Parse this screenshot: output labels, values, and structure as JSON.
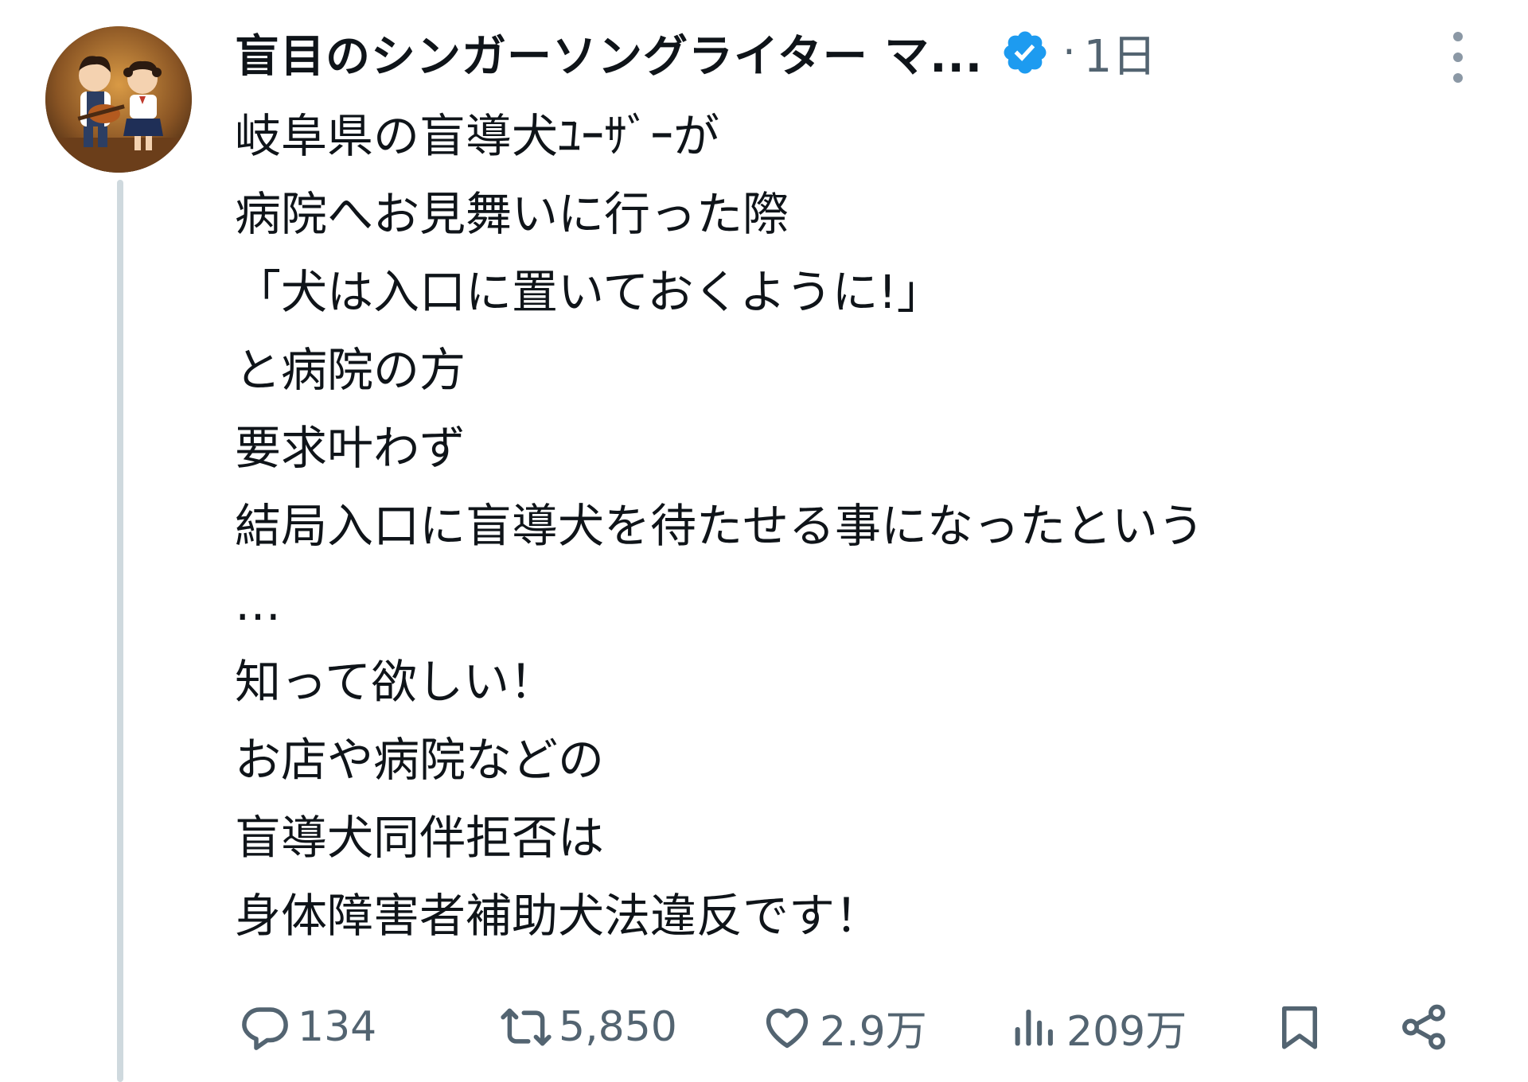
{
  "author": {
    "display_name": "盲目のシンガーソングライター マ...",
    "verified": true,
    "separator": "·",
    "timestamp": "1日",
    "avatar_icon": "avatar-image"
  },
  "tweet": {
    "lines": [
      "岐阜県の盲導犬ﾕｰｻﾞｰが",
      "病院へお見舞いに行った際",
      "「犬は入口に置いておくように!」",
      "と病院の方",
      "要求叶わず",
      "結局入口に盲導犬を待たせる事になったという",
      "…",
      "知って欲しい！",
      "お店や病院などの",
      "盲導犬同伴拒否は",
      "身体障害者補助犬法違反です！"
    ]
  },
  "actions": {
    "reply": {
      "icon": "reply-icon",
      "count": "134"
    },
    "retweet": {
      "icon": "retweet-icon",
      "count": "5,850"
    },
    "like": {
      "icon": "heart-icon",
      "count": "2.9万"
    },
    "views": {
      "icon": "views-icon",
      "count": "209万"
    },
    "bookmark": {
      "icon": "bookmark-icon"
    },
    "share": {
      "icon": "share-icon"
    }
  },
  "colors": {
    "verified_blue": "#1d9bf0",
    "muted_text": "#536471",
    "thread_line": "#cfd9de",
    "text": "#0f1419"
  }
}
